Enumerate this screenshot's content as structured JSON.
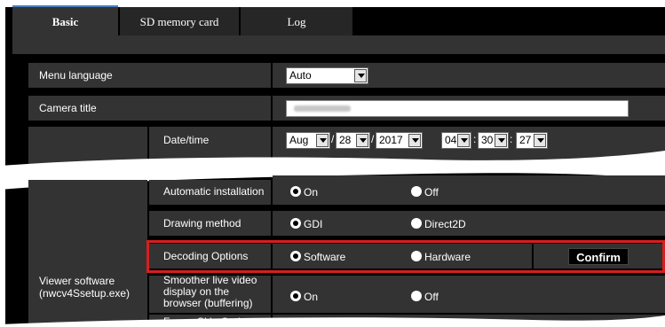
{
  "tabs": [
    "Basic",
    "SD memory card",
    "Log"
  ],
  "rows": {
    "menu_language": {
      "label": "Menu language",
      "value": "Auto"
    },
    "camera_title": {
      "label": "Camera title"
    },
    "date_time": {
      "label": "Date/time",
      "month": "Aug",
      "day": "28",
      "year": "2017",
      "hour": "04",
      "minute": "30",
      "second": "27",
      "sep_slash": "/",
      "sep_colon": ":"
    },
    "viewer_software": {
      "label_line1": "Viewer software",
      "label_line2": "(nwcv4Ssetup.exe)",
      "automatic_installation": {
        "label": "Automatic installation",
        "opt1": "On",
        "opt2": "Off",
        "selected": "On"
      },
      "drawing_method": {
        "label": "Drawing method",
        "opt1": "GDI",
        "opt2": "Direct2D",
        "selected": "GDI"
      },
      "decoding_options": {
        "label": "Decoding Options",
        "opt1": "Software",
        "opt2": "Hardware",
        "selected": "Software",
        "button": "Confirm"
      },
      "smoother_live_video": {
        "label_line1": "Smoother live video",
        "label_line2": "display on the",
        "label_line3": "browser (buffering)",
        "opt1": "On",
        "opt2": "Off",
        "selected": "On"
      },
      "frame_skip_options": {
        "label": "Frame Skip Options"
      }
    }
  },
  "colors": {
    "highlight": "#d81e1e",
    "tab_accent": "#4a7fc0"
  }
}
